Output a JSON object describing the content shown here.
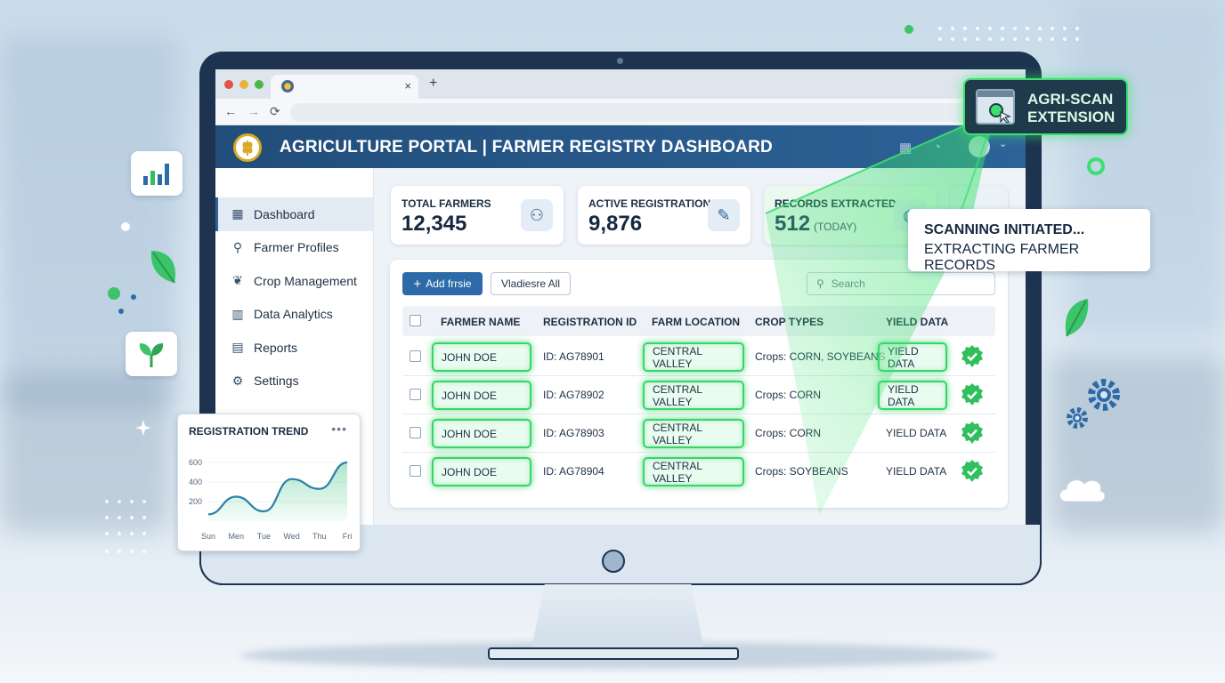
{
  "browser": {
    "tab_close": "×",
    "new_tab": "+",
    "nav_back": "←",
    "nav_forward": "→",
    "nav_reload": "⟳"
  },
  "header": {
    "title": "AGRICULTURE PORTAL | FARMER REGISTRY DASHBOARD",
    "chevron": "⌄"
  },
  "sidebar": {
    "items": [
      {
        "label": "Dashboard",
        "icon": "grid-icon",
        "glyph": "▦",
        "active": true
      },
      {
        "label": "Farmer Profiles",
        "icon": "user-icon",
        "glyph": "⚲",
        "active": false
      },
      {
        "label": "Crop Management",
        "icon": "sprout-icon",
        "glyph": "❦",
        "active": false
      },
      {
        "label": "Data Analytics",
        "icon": "bar-chart-icon",
        "glyph": "▥",
        "active": false
      },
      {
        "label": "Reports",
        "icon": "document-icon",
        "glyph": "▤",
        "active": false
      },
      {
        "label": "Settings",
        "icon": "gear-icon",
        "glyph": "⚙",
        "active": false
      }
    ]
  },
  "stats": [
    {
      "label": "TOTAL FARMERS",
      "value": "12,345",
      "sub": "",
      "icon": "users-icon",
      "glyph": "⚇"
    },
    {
      "label": "ACTIVE REGISTRATIONS",
      "value": "9,876",
      "sub": "",
      "icon": "clipboard-icon",
      "glyph": "✎"
    },
    {
      "label": "RECORDS EXTRACTED",
      "value": "512",
      "sub": "(TODAY)",
      "icon": "globe-icon",
      "glyph": "◍"
    }
  ],
  "toolbar": {
    "add_label": "Add frrsie",
    "add_glyph": "+",
    "secondary_label": "Vladiesre All",
    "search_placeholder": "Search",
    "search_glyph": "⚲"
  },
  "table": {
    "columns": [
      "FARMER NAME",
      "REGISTRATION ID",
      "FARM LOCATION",
      "CROP TYPES",
      "YIELD DATA"
    ],
    "rows": [
      {
        "name": "JOHN DOE",
        "id": "ID: AG78901",
        "location": "CENTRAL VALLEY",
        "crops": "Crops: CORN, SOYBEANS",
        "yield": "YIELD DATA",
        "yield_highlight": true
      },
      {
        "name": "JOHN DOE",
        "id": "ID: AG78902",
        "location": "CENTRAL VALLEY",
        "crops": "Crops: CORN",
        "yield": "YIELD DATA",
        "yield_highlight": true
      },
      {
        "name": "JOHN DOE",
        "id": "ID: AG78903",
        "location": "CENTRAL VALLEY",
        "crops": "Crops: CORN",
        "yield": "YIELD DATA",
        "yield_highlight": false
      },
      {
        "name": "JOHN DOE",
        "id": "ID: AG78904",
        "location": "CENTRAL VALLEY",
        "crops": "Crops: SOYBEANS",
        "yield": "YIELD DATA",
        "yield_highlight": false
      }
    ]
  },
  "extension": {
    "line1": "AGRI-SCAN",
    "line2": "EXTENSION"
  },
  "scan_status": {
    "line1": "SCANNING INITIATED...",
    "line2": "EXTRACTING FARMER RECORDS"
  },
  "trend": {
    "title": "REGISTRATION TREND",
    "more": "•••"
  },
  "chart_data": {
    "type": "area",
    "title": "REGISTRATION TREND",
    "categories": [
      "Sun",
      "Men",
      "Tue",
      "Wed",
      "Thu",
      "Fri"
    ],
    "values": [
      70,
      250,
      100,
      430,
      330,
      600
    ],
    "ylim": [
      0,
      600
    ],
    "yticks": [
      600,
      400,
      200
    ],
    "xlabel": "",
    "ylabel": ""
  },
  "colors": {
    "header": "#2d6398",
    "accent_green": "#39d46a",
    "primary_button": "#2d6aa8"
  }
}
